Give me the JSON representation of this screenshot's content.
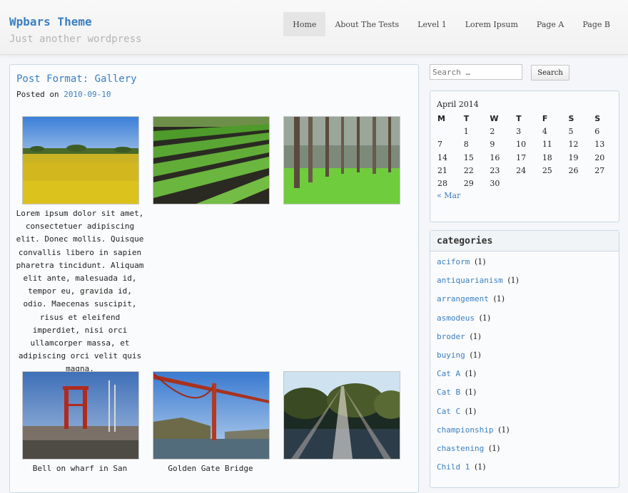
{
  "site": {
    "title": "Wpbars Theme",
    "description": "Just another wordpress"
  },
  "nav": {
    "items": [
      {
        "label": "Home",
        "active": true
      },
      {
        "label": "About The Tests",
        "active": false
      },
      {
        "label": "Level 1",
        "active": false
      },
      {
        "label": "Lorem Ipsum",
        "active": false
      },
      {
        "label": "Page A",
        "active": false
      },
      {
        "label": "Page B",
        "active": false
      }
    ]
  },
  "post": {
    "title": "Post Format: Gallery",
    "posted_on_label": "Posted on",
    "date": "2010-09-10",
    "gallery": [
      {
        "scene": "rapeseed-field",
        "caption": "Lorem ipsum dolor sit amet, consectetuer adipiscing elit. Donec mollis. Quisque convallis libero in sapien pharetra tincidunt. Aliquam elit ante, malesuada id, tempor eu, gravida id, odio. Maecenas suscipit, risus et eleifend imperdiet, nisi orci ullamcorper massa, et adipiscing orci velit quis magna."
      },
      {
        "scene": "crop-rows",
        "caption": ""
      },
      {
        "scene": "pine-forest",
        "caption": ""
      },
      {
        "scene": "wharf-tower",
        "caption": "Bell on wharf in San"
      },
      {
        "scene": "golden-gate-bridge",
        "caption": "Golden Gate Bridge"
      },
      {
        "scene": "sunlit-lake",
        "caption": ""
      }
    ]
  },
  "search": {
    "placeholder": "Search …",
    "button_label": "Search"
  },
  "calendar": {
    "caption": "April 2014",
    "weekdays": [
      "M",
      "T",
      "W",
      "T",
      "F",
      "S",
      "S"
    ],
    "weeks": [
      [
        "",
        "1",
        "2",
        "3",
        "4",
        "5",
        "6"
      ],
      [
        "7",
        "8",
        "9",
        "10",
        "11",
        "12",
        "13"
      ],
      [
        "14",
        "15",
        "16",
        "17",
        "18",
        "19",
        "20"
      ],
      [
        "21",
        "22",
        "23",
        "24",
        "25",
        "26",
        "27"
      ],
      [
        "28",
        "29",
        "30",
        "",
        "",
        "",
        ""
      ]
    ],
    "prev_link": "« Mar"
  },
  "categories": {
    "title": "categories",
    "items": [
      {
        "name": "aciform",
        "count": "(1)"
      },
      {
        "name": "antiquarianism",
        "count": "(1)"
      },
      {
        "name": "arrangement",
        "count": "(1)"
      },
      {
        "name": "asmodeus",
        "count": "(1)"
      },
      {
        "name": "broder",
        "count": "(1)"
      },
      {
        "name": "buying",
        "count": "(1)"
      },
      {
        "name": "Cat A",
        "count": "(1)"
      },
      {
        "name": "Cat B",
        "count": "(1)"
      },
      {
        "name": "Cat C",
        "count": "(1)"
      },
      {
        "name": "championship",
        "count": "(1)"
      },
      {
        "name": "chastening",
        "count": "(1)"
      },
      {
        "name": "Child 1",
        "count": "(1)"
      }
    ]
  },
  "colors": {
    "link": "#3a7fc1",
    "border": "#c8d8e6"
  }
}
